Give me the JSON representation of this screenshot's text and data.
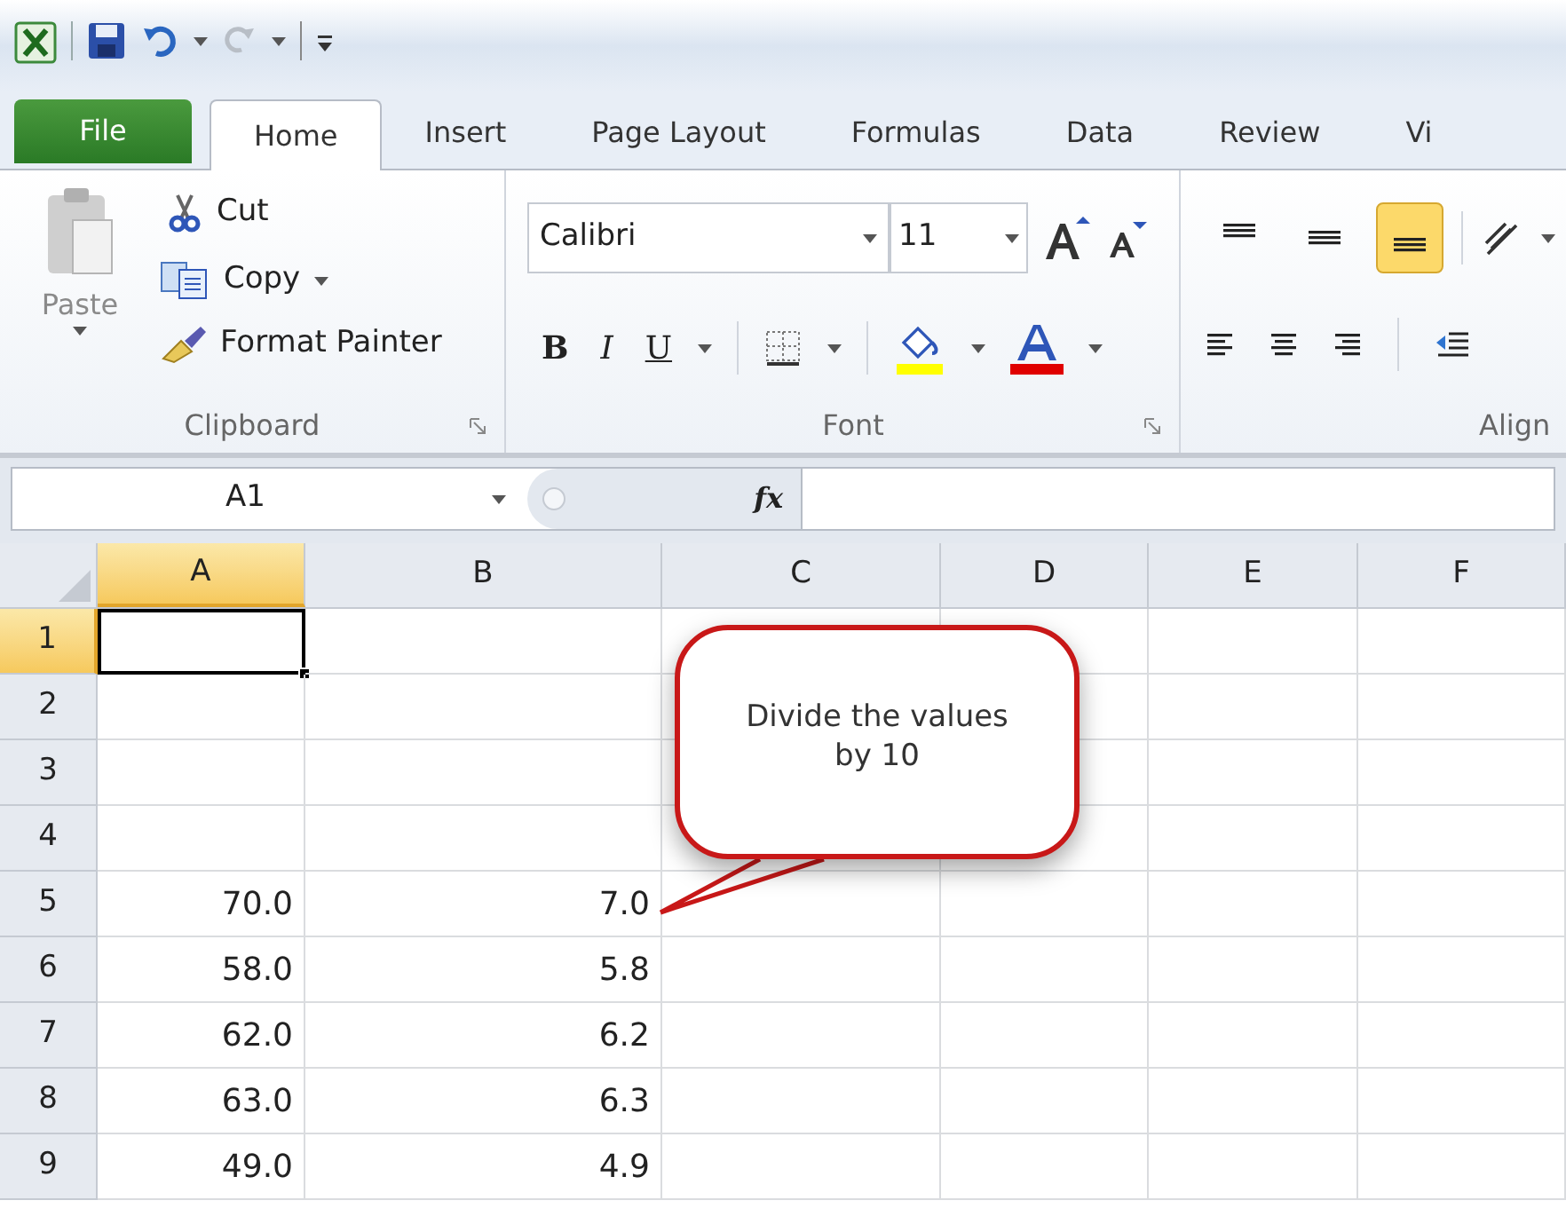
{
  "tabs": [
    {
      "label": "File",
      "kind": "file",
      "selected": false
    },
    {
      "label": "Home",
      "kind": "normal",
      "selected": true
    },
    {
      "label": "Insert",
      "kind": "normal",
      "selected": false
    },
    {
      "label": "Page Layout",
      "kind": "normal",
      "selected": false
    },
    {
      "label": "Formulas",
      "kind": "normal",
      "selected": false
    },
    {
      "label": "Data",
      "kind": "normal",
      "selected": false
    },
    {
      "label": "Review",
      "kind": "normal",
      "selected": false
    },
    {
      "label": "Vi",
      "kind": "normal",
      "selected": false
    }
  ],
  "clipboard": {
    "paste": "Paste",
    "cut": "Cut",
    "copy": "Copy",
    "format_painter": "Format Painter",
    "label": "Clipboard"
  },
  "font": {
    "font_name": "Calibri",
    "font_size": "11",
    "bold": "B",
    "italic": "I",
    "underline": "U",
    "label": "Font"
  },
  "alignment": {
    "label": "Align",
    "vertical": [
      {
        "selected": false
      },
      {
        "selected": false
      },
      {
        "selected": true
      }
    ]
  },
  "formula_bar": {
    "name_box": "A1",
    "function_label": "fx"
  },
  "sheet": {
    "columns": [
      {
        "label": "A",
        "selected": true
      },
      {
        "label": "B",
        "selected": false
      },
      {
        "label": "C",
        "selected": false
      },
      {
        "label": "D",
        "selected": false
      },
      {
        "label": "E",
        "selected": false
      },
      {
        "label": "F",
        "selected": false
      }
    ],
    "rows": [
      {
        "label": "1",
        "selected": true,
        "cells": [
          {
            "selected": true
          },
          {
            "selected": false
          }
        ]
      },
      {
        "label": "2",
        "selected": false
      },
      {
        "label": "3",
        "selected": false
      },
      {
        "label": "4",
        "selected": false
      },
      {
        "label": "5",
        "selected": false,
        "cells": [
          {
            "value": "70.0",
            "selected": false
          },
          {
            "value": "7.0",
            "selected": false
          }
        ]
      },
      {
        "label": "6",
        "selected": false,
        "cells": [
          {
            "value": "58.0",
            "selected": false
          },
          {
            "value": "5.8",
            "selected": false
          }
        ]
      },
      {
        "label": "7",
        "selected": false,
        "cells": [
          {
            "value": "62.0",
            "selected": false
          },
          {
            "value": "6.2",
            "selected": false
          }
        ]
      },
      {
        "label": "8",
        "selected": false,
        "cells": [
          {
            "value": "63.0",
            "selected": false
          },
          {
            "value": "6.3",
            "selected": false
          }
        ]
      },
      {
        "label": "9",
        "selected": false,
        "cells": [
          {
            "value": "49.0",
            "selected": false
          },
          {
            "value": "4.9",
            "selected": false
          }
        ]
      }
    ]
  },
  "callout": {
    "text": "Divide the values\nby 10"
  }
}
